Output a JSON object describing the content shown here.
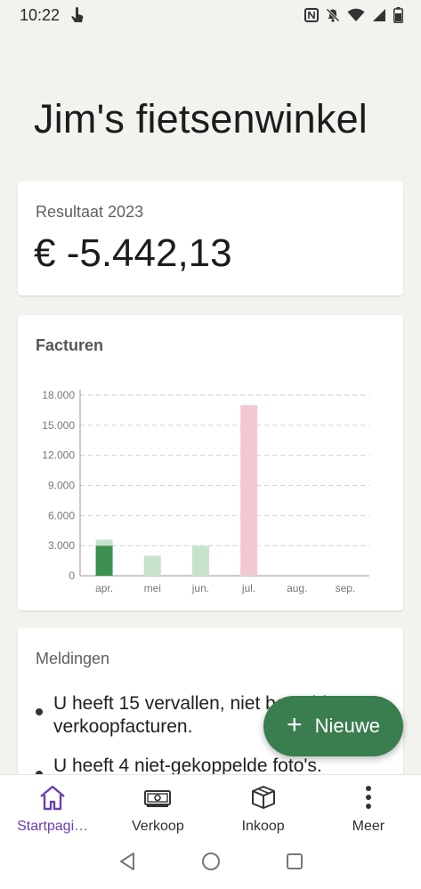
{
  "status_bar": {
    "time": "10:22",
    "icons": [
      "touch-icon",
      "nfc-icon",
      "mute-icon",
      "wifi-icon",
      "signal-icon",
      "battery-icon"
    ]
  },
  "app": {
    "title": "Jim's fietsenwinkel"
  },
  "result": {
    "label": "Resultaat 2023",
    "value": "€ -5.442,13"
  },
  "invoices": {
    "title": "Facturen"
  },
  "chart_data": {
    "type": "bar",
    "title": "Facturen",
    "categories": [
      "apr.",
      "mei",
      "jun.",
      "jul.",
      "aug.",
      "sep."
    ],
    "series": [
      {
        "values": [
          3000,
          0,
          0,
          0,
          0,
          0
        ],
        "color": "#3d9150"
      },
      {
        "values": [
          600,
          2000,
          3000,
          0,
          0,
          0
        ],
        "color": "#c8e3cb"
      },
      {
        "values": [
          0,
          0,
          0,
          17000,
          0,
          0
        ],
        "color": "#f2c9d0"
      }
    ],
    "y_ticks": [
      "0",
      "3.000",
      "6.000",
      "9.000",
      "12.000",
      "15.000",
      "18.000"
    ],
    "ylim": [
      0,
      18000
    ],
    "grid": true
  },
  "notifications": {
    "title": "Meldingen",
    "items": [
      "U heeft 15 vervallen, niet betaalde verkoopfacturen.",
      "U heeft 4 niet-gekoppelde foto's."
    ]
  },
  "fab": {
    "label": "Nieuwe"
  },
  "bottom_nav": [
    {
      "label": "Startpagi…",
      "icon": "home-icon",
      "active": true
    },
    {
      "label": "Verkoop",
      "icon": "cash-icon",
      "active": false
    },
    {
      "label": "Inkoop",
      "icon": "box-icon",
      "active": false
    },
    {
      "label": "Meer",
      "icon": "more-vert-icon",
      "active": false
    }
  ],
  "colors": {
    "accent": "#3a7d4f",
    "nav_active": "#6b3fb0",
    "background": "#f3f2ee"
  }
}
